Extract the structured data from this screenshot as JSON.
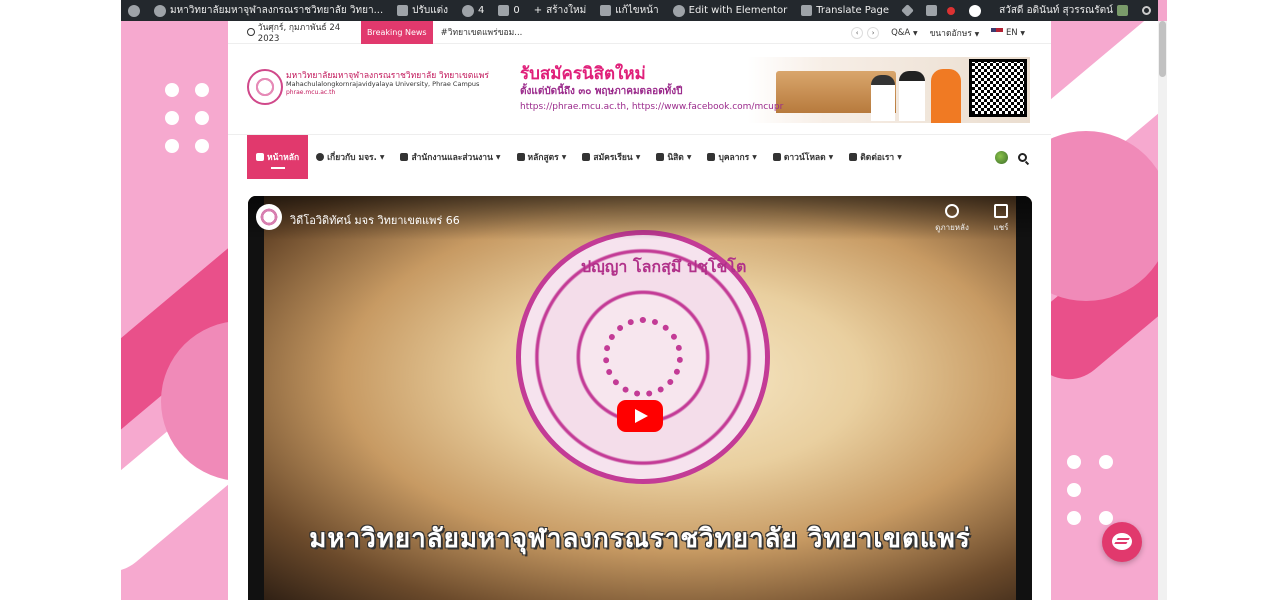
{
  "admin_bar": {
    "site_name": "มหาวิทยาลัยมหาจุฬาลงกรณราชวิทยาลัย วิทยา...",
    "customize": "ปรับแต่ง",
    "updates_count": "4",
    "comments_count": "0",
    "new": "สร้างใหม่",
    "edit_page": "แก้ไขหน้า",
    "elementor": "Edit with Elementor",
    "translate": "Translate Page",
    "greeting": "สวัสดี อดินันท์ สุวรรณรัตน์"
  },
  "topbar": {
    "date": "วันศุกร์, กุมภาพันธ์ 24 2023",
    "breaking_label": "Breaking News",
    "ticker": "#วิทยาเขตแพร่ขอม...",
    "prev_icon": "‹",
    "next_icon": "›",
    "qa": "Q&A",
    "font_size": "ขนาดอักษร",
    "language": "EN"
  },
  "header": {
    "logo_title": "มหาวิทยาลัยมหาจุฬาลงกรณราชวิทยาลัย วิทยาเขตแพร่",
    "logo_subtitle": "Mahachulalongkornrajavidyalaya University, Phrae Campus",
    "logo_url": "phrae.mcu.ac.th",
    "banner_headline": "รับสมัครนิสิตใหม่",
    "banner_period": "ตั้งแต่บัดนี้ถึง ๓๐ พฤษภาคมตลอดทั้งปี",
    "banner_links": "https://phrae.mcu.ac.th, https://www.facebook.com/mcupr"
  },
  "nav": {
    "items": [
      {
        "label": "หน้าหลัก",
        "icon": "home-icon"
      },
      {
        "label": "เกี่ยวกับ มจร.",
        "icon": "info-icon"
      },
      {
        "label": "สำนักงานและส่วนงาน",
        "icon": "building-icon"
      },
      {
        "label": "หลักสูตร",
        "icon": "book-icon"
      },
      {
        "label": "สมัครเรียน",
        "icon": "graduation-icon"
      },
      {
        "label": "นิสิต",
        "icon": "student-icon"
      },
      {
        "label": "บุคลากร",
        "icon": "user-icon"
      },
      {
        "label": "ดาวน์โหลด",
        "icon": "download-icon"
      },
      {
        "label": "ติดต่อเรา",
        "icon": "address-card-icon"
      }
    ]
  },
  "video": {
    "title": "วิดีโอวิดิทัศน์ มจร วิทยาเขตแพร่ 66",
    "watch_later": "ดูภายหลัง",
    "share": "แชร์",
    "seal_top_text": "ปญฺญา  โลกสฺมึ  ปชฺโชโต",
    "caption": "มหาวิทยาลัยมหาจุฬาลงกรณราชวิทยาลัย วิทยาเขตแพร่"
  },
  "colors": {
    "accent": "#e1396d",
    "page_bg": "#f6a9cf",
    "admin_bar": "#23282d"
  }
}
